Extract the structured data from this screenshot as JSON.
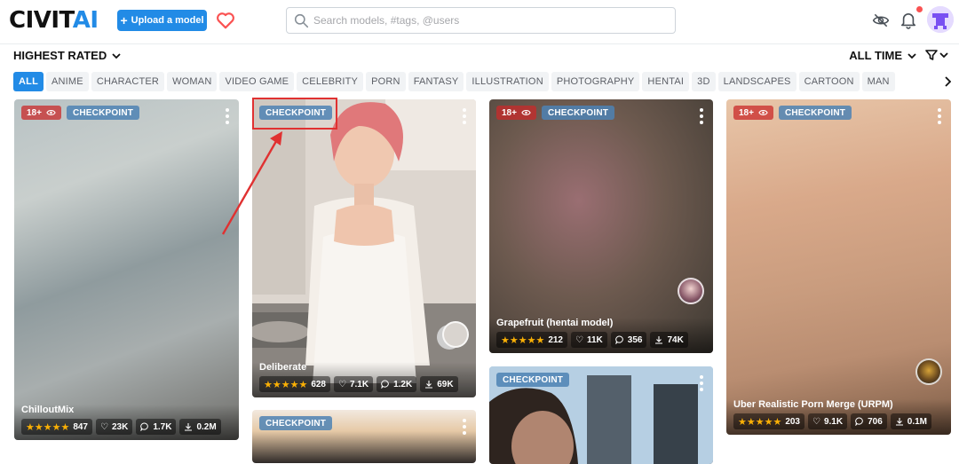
{
  "header": {
    "logo_main": "CIVIT",
    "logo_accent": "AI",
    "upload_label": "Upload a model",
    "search_placeholder": "Search models, #tags, @users"
  },
  "sortbar": {
    "sort_label": "HIGHEST RATED",
    "period_label": "ALL TIME"
  },
  "tags": [
    "ALL",
    "ANIME",
    "CHARACTER",
    "WOMAN",
    "VIDEO GAME",
    "CELEBRITY",
    "PORN",
    "FANTASY",
    "ILLUSTRATION",
    "PHOTOGRAPHY",
    "HENTAI",
    "3D",
    "LANDSCAPES",
    "CARTOON",
    "MAN"
  ],
  "cards": [
    {
      "nsfw": "18+",
      "type": "CHECKPOINT",
      "title": "ChilloutMix",
      "stars": "★★★★★",
      "rating_count": "847",
      "likes": "23K",
      "comments": "1.7K",
      "downloads": "0.2M"
    },
    {
      "type": "CHECKPOINT",
      "title": "Deliberate",
      "stars": "★★★★★",
      "rating_count": "628",
      "likes": "7.1K",
      "comments": "1.2K",
      "downloads": "69K"
    },
    {
      "nsfw": "18+",
      "type": "CHECKPOINT",
      "title": "Grapefruit (hentai model)",
      "stars": "★★★★★",
      "rating_count": "212",
      "likes": "11K",
      "comments": "356",
      "downloads": "74K"
    },
    {
      "nsfw": "18+",
      "type": "CHECKPOINT",
      "title": "Uber Realistic Porn Merge (URPM)",
      "stars": "★★★★★",
      "rating_count": "203",
      "likes": "9.1K",
      "comments": "706",
      "downloads": "0.1M"
    },
    {
      "type": "CHECKPOINT"
    },
    {
      "type": "CHECKPOINT"
    }
  ],
  "colors": {
    "accent": "#228be6",
    "nsfw_badge": "#c92a2a",
    "checkpoint_badge": "#4d82b4",
    "star": "#fab005",
    "annotation": "#e03131"
  }
}
